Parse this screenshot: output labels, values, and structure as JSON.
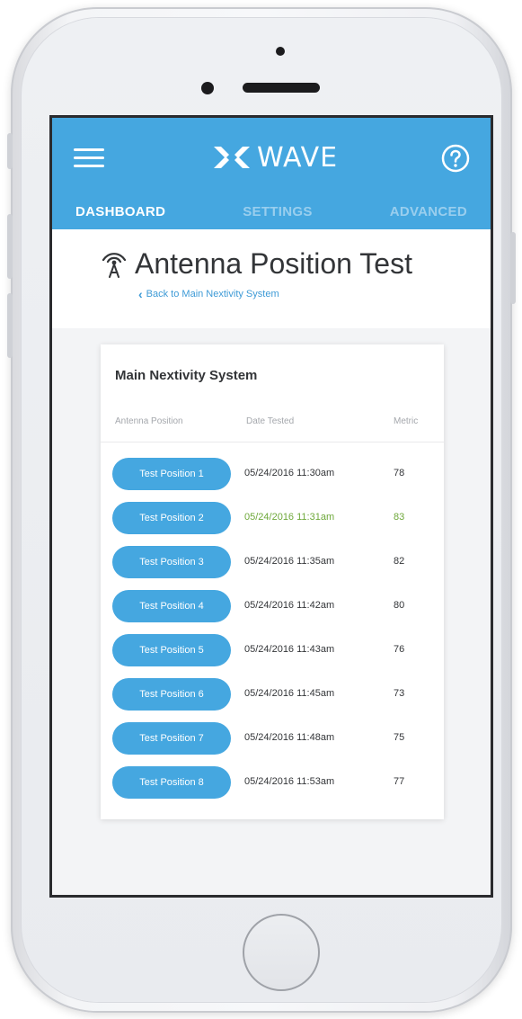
{
  "header": {
    "brand": "WAVE",
    "brand_color": "#45a7e0",
    "menu_icon": "hamburger-menu-icon",
    "help_icon": "question-circle-icon"
  },
  "tabs": [
    {
      "label": "DASHBOARD",
      "active": true
    },
    {
      "label": "SETTINGS",
      "active": false
    },
    {
      "label": "ADVANCED",
      "active": false
    }
  ],
  "page": {
    "icon": "antenna-icon",
    "title": "Antenna Position Test",
    "back_link": "Back to Main Nextivity System"
  },
  "card": {
    "title": "Main Nextivity System",
    "columns": {
      "position": "Antenna Position",
      "date": "Date Tested",
      "metric": "Metric"
    },
    "rows": [
      {
        "position": "Test Position 1",
        "date": "05/24/2016 11:30am",
        "metric": "78",
        "highlight": false
      },
      {
        "position": "Test Position 2",
        "date": "05/24/2016 11:31am",
        "metric": "83",
        "highlight": true
      },
      {
        "position": "Test Position 3",
        "date": "05/24/2016 11:35am",
        "metric": "82",
        "highlight": false
      },
      {
        "position": "Test Position 4",
        "date": "05/24/2016 11:42am",
        "metric": "80",
        "highlight": false
      },
      {
        "position": "Test Position 5",
        "date": "05/24/2016 11:43am",
        "metric": "76",
        "highlight": false
      },
      {
        "position": "Test Position 6",
        "date": "05/24/2016 11:45am",
        "metric": "73",
        "highlight": false
      },
      {
        "position": "Test Position 7",
        "date": "05/24/2016 11:48am",
        "metric": "75",
        "highlight": false
      },
      {
        "position": "Test Position 8",
        "date": "05/24/2016 11:53am",
        "metric": "77",
        "highlight": false
      }
    ],
    "highlight_color": "#6ea83a"
  }
}
